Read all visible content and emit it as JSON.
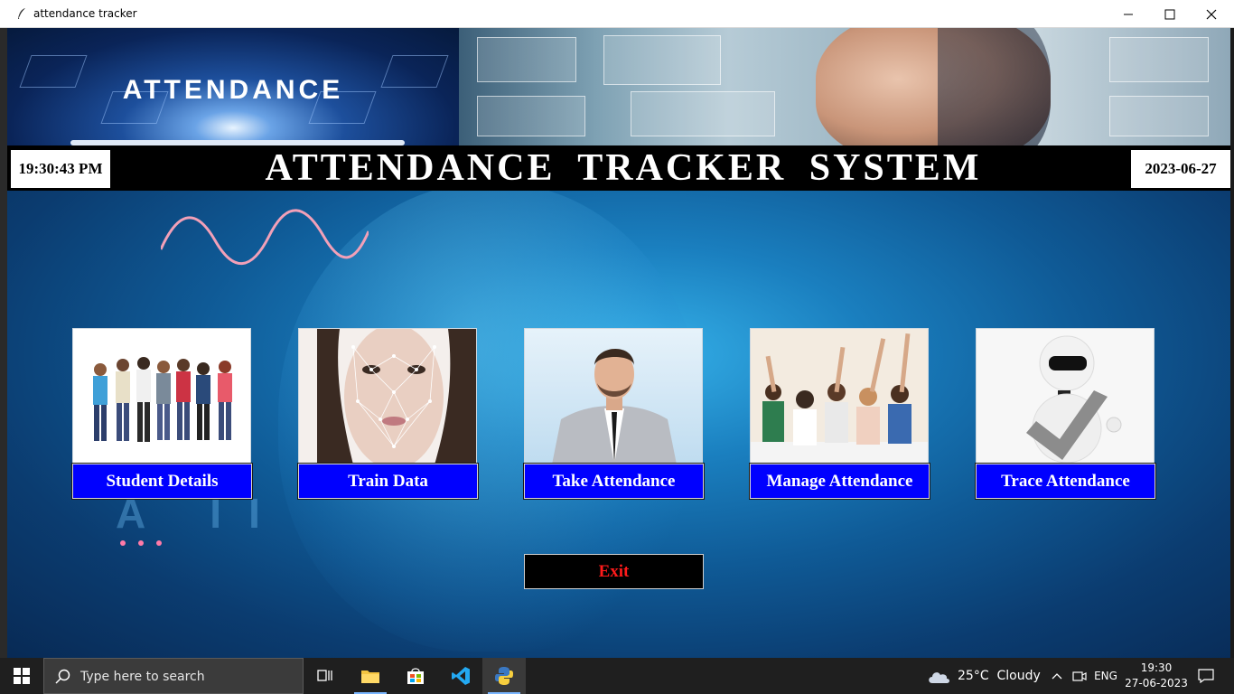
{
  "window": {
    "title": "attendance tracker"
  },
  "banner": {
    "logo_text": "ATTENDANCE"
  },
  "header": {
    "time": "19:30:43 PM",
    "title": "ATTENDANCE TRACKER SYSTEM",
    "date": "2023-06-27"
  },
  "tiles": [
    {
      "label": "Student Details",
      "icon": "students-photo"
    },
    {
      "label": "Train Data",
      "icon": "face-mesh-photo"
    },
    {
      "label": "Take Attendance",
      "icon": "person-photo"
    },
    {
      "label": "Manage Attendance",
      "icon": "classroom-photo"
    },
    {
      "label": "Trace Attendance",
      "icon": "robot-checkmark-photo"
    }
  ],
  "exit": {
    "label": "Exit"
  },
  "colors": {
    "tile_button": "#0000ff",
    "exit_text": "#ff1a1a",
    "header_bar": "#000000"
  },
  "taskbar": {
    "search_placeholder": "Type here to search",
    "weather": "25°C  Cloudy",
    "language": "ENG",
    "clock_time": "19:30",
    "clock_date": "27-06-2023"
  }
}
